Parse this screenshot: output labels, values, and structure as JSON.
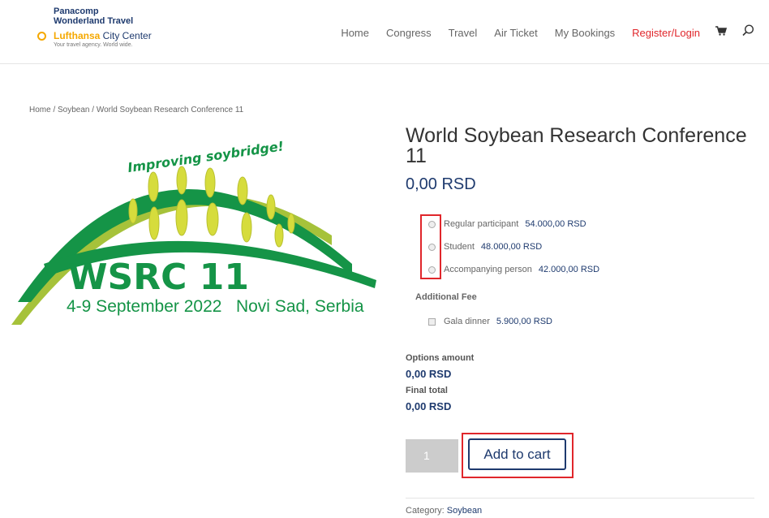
{
  "logo": {
    "line1": "Panacomp",
    "line2": "Wonderland Travel",
    "brand_bold": "Lufthansa",
    "brand_rest": " City Center",
    "tagline": "Your travel agency. World wide."
  },
  "nav": {
    "items": [
      "Home",
      "Congress",
      "Travel",
      "Air Ticket",
      "My Bookings"
    ],
    "register_login": "Register/Login",
    "icons": [
      "cart-icon",
      "search-icon"
    ]
  },
  "breadcrumb": "Home / Soybean / World Soybean Research Conference 11",
  "product_image": {
    "arc_text": "Improving soybridge!",
    "main_text": "WSRC 11",
    "date_location": "4-9 September 2022   Novi Sad, Serbia",
    "colors": {
      "green": "#159447",
      "lime": "#a6c23a",
      "yellow": "#d6dc3c"
    }
  },
  "product": {
    "title": "World Soybean Research Conference 11",
    "price": "0,00 RSD",
    "options": [
      {
        "label": "Regular participant",
        "amount": "54.000,00 RSD"
      },
      {
        "label": "Student",
        "amount": "48.000,00 RSD"
      },
      {
        "label": "Accompanying person",
        "amount": "42.000,00 RSD"
      }
    ],
    "additional_fee_heading": "Additional Fee",
    "additional": {
      "label": "Gala dinner",
      "amount": "5.900,00 RSD"
    },
    "options_amount_label": "Options amount",
    "options_amount": "0,00 RSD",
    "final_total_label": "Final total",
    "final_total": "0,00 RSD",
    "quantity": "1",
    "add_to_cart": "Add to cart",
    "category_label": "Category: ",
    "category": "Soybean"
  },
  "colors": {
    "accent": "#1e3a6e",
    "highlight": "#e0262b"
  }
}
